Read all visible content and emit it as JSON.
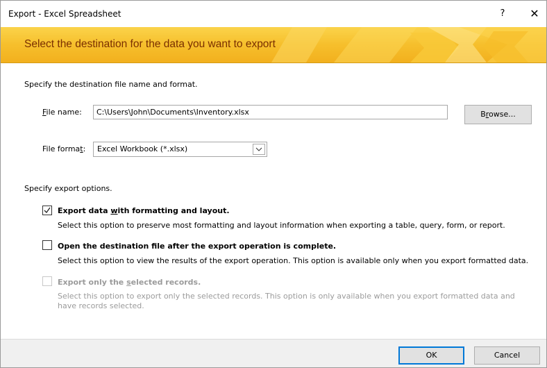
{
  "window": {
    "title": "Export - Excel Spreadsheet",
    "help_label": "?",
    "close_label": "✕"
  },
  "banner": {
    "heading": "Select the destination for the data you want to export",
    "color": "#f6bf2c"
  },
  "destination": {
    "section_label": "Specify the destination file name and format.",
    "file_name_label_pre": "",
    "file_name_label_acc": "F",
    "file_name_label_post": "ile name:",
    "file_name_value": "C:\\Users\\John\\Documents\\Inventory.xlsx",
    "browse_label_pre": "B",
    "browse_label_acc": "r",
    "browse_label_post": "owse...",
    "file_format_label_pre": "File forma",
    "file_format_label_acc": "t",
    "file_format_label_post": ":",
    "file_format_value": "Excel Workbook (*.xlsx)"
  },
  "options": {
    "section_label": "Specify export options.",
    "items": [
      {
        "title_pre": "Export data ",
        "title_acc": "w",
        "title_post": "ith formatting and layout.",
        "description": "Select this option to preserve most formatting and layout information when exporting a table, query, form, or report.",
        "checked": true,
        "enabled": true
      },
      {
        "title_pre": "Open the destination file after the export operation is complete.",
        "title_acc": "",
        "title_post": "",
        "description": "Select this option to view the results of the export operation. This option is available only when you export formatted data.",
        "checked": false,
        "enabled": true
      },
      {
        "title_pre": "Export only the ",
        "title_acc": "s",
        "title_post": "elected records.",
        "description_line1": "Select this option to export only the selected records. This option is only available when you export formatted data and",
        "description_line2": "have records selected.",
        "checked": false,
        "enabled": false
      }
    ]
  },
  "footer": {
    "ok_label": "OK",
    "cancel_label": "Cancel"
  }
}
